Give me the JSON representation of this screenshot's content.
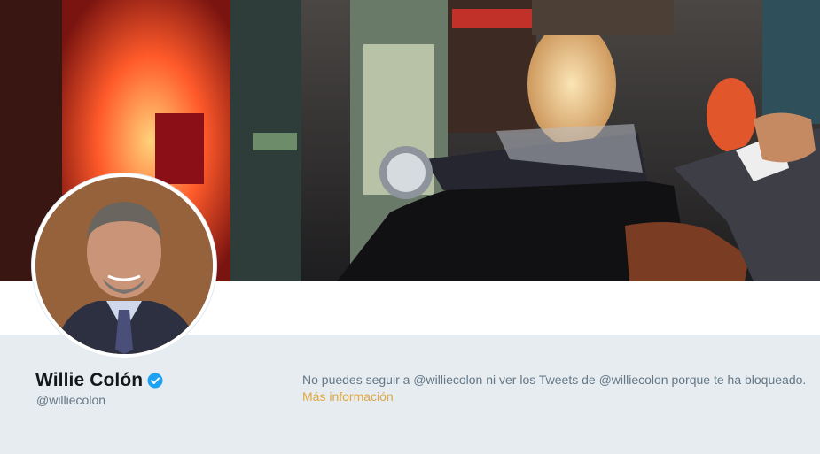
{
  "profile": {
    "name": "Willie Colón",
    "handle": "@williecolon"
  },
  "notice": {
    "message": "No puedes seguir a @williecolon ni ver los Tweets de @williecolon porque te ha bloqueado.",
    "link_label": "Más información"
  },
  "colors": {
    "link": "#e0a840",
    "verified": "#1da1f2",
    "muted_text": "#657786"
  }
}
